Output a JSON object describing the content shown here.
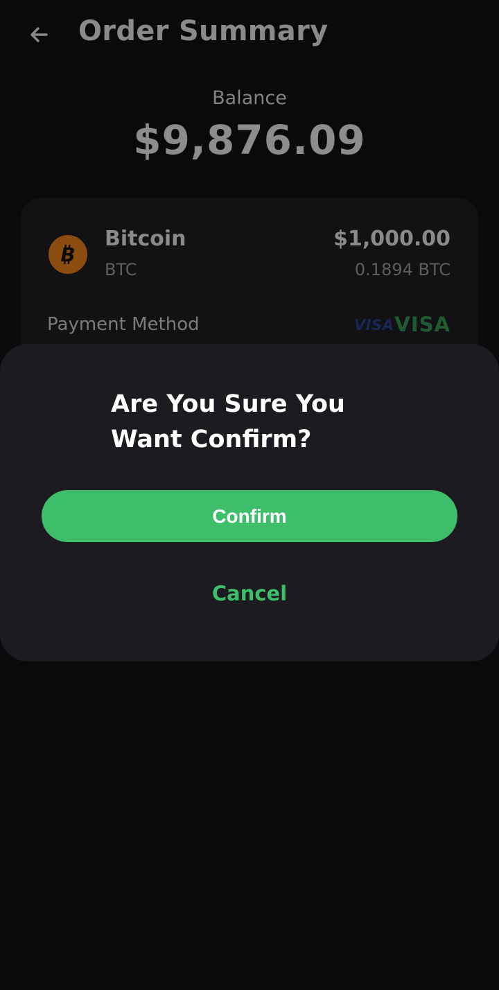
{
  "header": {
    "title": "Order Summary",
    "back_icon": "arrow-left-icon"
  },
  "balance": {
    "label": "Balance",
    "value": "$9,876.09"
  },
  "order": {
    "coin_name": "Bitcoin",
    "coin_symbol": "BTC",
    "coin_icon": "bitcoin-icon",
    "amount": "$1,000.00",
    "crypto_amount": "0.1894 BTC"
  },
  "payment": {
    "label": "Payment Method",
    "logo_text": "VISA",
    "method_text": "VISA"
  },
  "dialog": {
    "title": "Are You Sure You Want Confirm?",
    "confirm_label": "Confirm",
    "cancel_label": "Cancel"
  },
  "colors": {
    "accent": "#3ebe6a",
    "background": "#0a0a0c",
    "sheet": "#1c1c20",
    "bitcoin": "#8a4c0f"
  }
}
